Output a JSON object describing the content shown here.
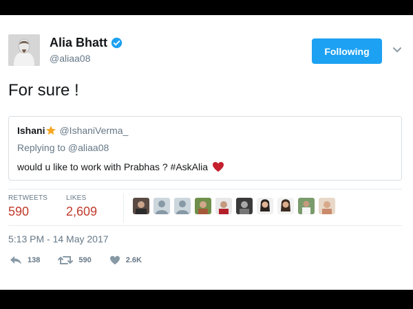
{
  "tweet": {
    "author_name": "Alia Bhatt",
    "author_handle": "@aliaa08",
    "follow_label": "Following",
    "text": "For sure !",
    "timestamp": "5:13 PM - 14 May 2017"
  },
  "quoted": {
    "author_name": "Ishani",
    "author_handle": "@IshaniVerma_",
    "reply_text": "Replying to @aliaa08",
    "text": "would u like to work with Prabhas ? #AskAlia"
  },
  "stats": {
    "retweets_label": "RETWEETS",
    "retweets_value": "590",
    "likes_label": "LIKES",
    "likes_value": "2,609"
  },
  "actions": {
    "reply_count": "138",
    "retweet_count": "590",
    "like_count": "2.6K"
  },
  "icons": [
    "verified-badge-icon",
    "chevron-down-icon",
    "star-icon",
    "heart-icon",
    "reply-icon",
    "retweet-icon",
    "like-icon"
  ],
  "colors": {
    "accent": "#1da1f2",
    "stat_value": "#c0392b",
    "muted": "#657786",
    "heart": "#c4202e",
    "star": "#f5a623"
  }
}
